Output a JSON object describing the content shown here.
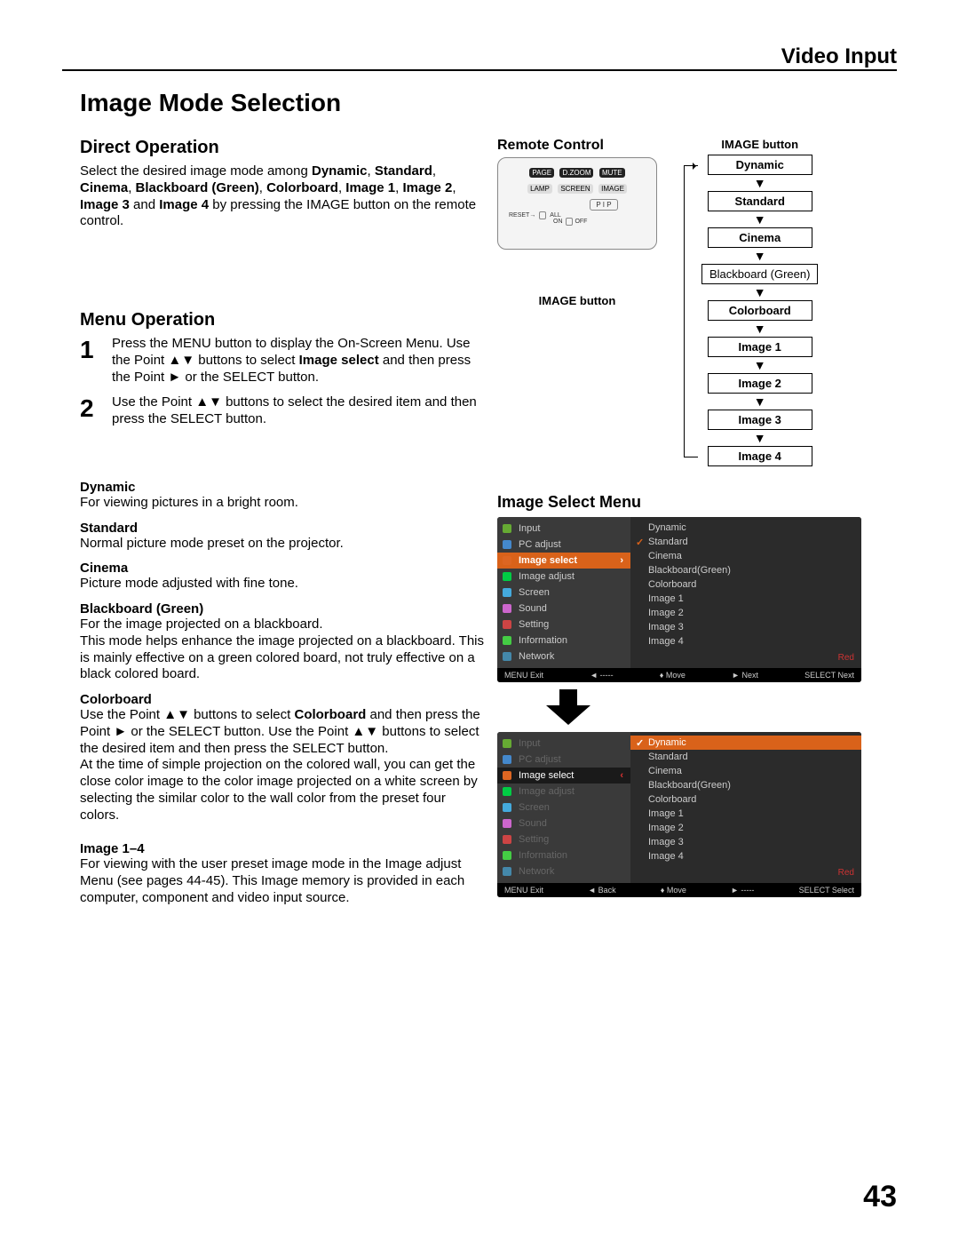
{
  "header": {
    "section": "Video Input",
    "title": "Image Mode Selection"
  },
  "direct": {
    "heading": "Direct Operation",
    "para": "Select the desired image mode among Dynamic, Standard, Cinema, Blackboard (Green), Colorboard, Image 1, Image 2, Image 3 and Image 4 by pressing the IMAGE button on the remote control."
  },
  "menu": {
    "heading": "Menu Operation",
    "steps": [
      {
        "num": "1",
        "text": "Press the MENU button to display the On-Screen Menu. Use the Point ▲▼ buttons to select Image select and then press the Point ► or the SELECT button."
      },
      {
        "num": "2",
        "text": "Use the Point ▲▼ buttons to select the desired item and then press the SELECT button."
      }
    ]
  },
  "modes": [
    {
      "title": "Dynamic",
      "desc": "For viewing pictures in a bright room."
    },
    {
      "title": "Standard",
      "desc": "Normal picture mode preset on the projector."
    },
    {
      "title": "Cinema",
      "desc": "Picture mode adjusted with fine tone."
    },
    {
      "title": "Blackboard (Green)",
      "desc": "For the image projected on a blackboard.\nThis mode helps enhance the image projected on a blackboard. This is mainly effective on a green colored board, not truly effective on a black colored board."
    },
    {
      "title": "Colorboard",
      "desc": "Use the Point ▲▼ buttons to select Colorboard and then press the Point ► or the SELECT button. Use the Point ▲▼ buttons to select the desired item and then press the SELECT button.\nAt the time of simple projection on the colored wall, you can get the close color image to the color image projected on a white screen by selecting the similar color to the wall color from the preset four colors."
    },
    {
      "title": "Image 1–4",
      "desc": "For viewing with the user preset image mode in the Image adjust Menu (see pages 44-45). This Image memory is provided in each computer, component and video input source."
    }
  ],
  "remote": {
    "heading": "Remote Control",
    "caption": "IMAGE button",
    "btns_top": [
      "PAGE",
      "D.ZOOM",
      "MUTE"
    ],
    "btns_mid": [
      "LAMP",
      "SCREEN",
      "IMAGE"
    ],
    "reset": "RESET",
    "on": "ON",
    "off": "OFF",
    "all": "ALL",
    "pip": "P I P"
  },
  "flow": {
    "title": "IMAGE button",
    "boxes": [
      "Dynamic",
      "Standard",
      "Cinema",
      "Blackboard (Green)",
      "Colorboard",
      "Image 1",
      "Image 2",
      "Image 3",
      "Image 4"
    ]
  },
  "osd": {
    "heading": "Image Select Menu",
    "left_items": [
      "Input",
      "PC adjust",
      "Image select",
      "Image adjust",
      "Screen",
      "Sound",
      "Setting",
      "Information",
      "Network"
    ],
    "right_items": [
      "Dynamic",
      "Standard",
      "Cinema",
      "Blackboard(Green)",
      "Colorboard",
      "Image 1",
      "Image 2",
      "Image 3",
      "Image 4"
    ],
    "tag": "Red",
    "foot1": {
      "exit": "MENU Exit",
      "back": "◄ -----",
      "move": "♦ Move",
      "next": "► Next",
      "select": "SELECT Next"
    },
    "foot2": {
      "exit": "MENU Exit",
      "back": "◄ Back",
      "move": "♦ Move",
      "next": "► -----",
      "select": "SELECT Select"
    },
    "icon_colors": [
      "#6a3",
      "#48c",
      "#d62",
      "#0c4",
      "#4ad",
      "#c6c",
      "#c44",
      "#4c4",
      "#48a"
    ]
  },
  "page_number": "43"
}
